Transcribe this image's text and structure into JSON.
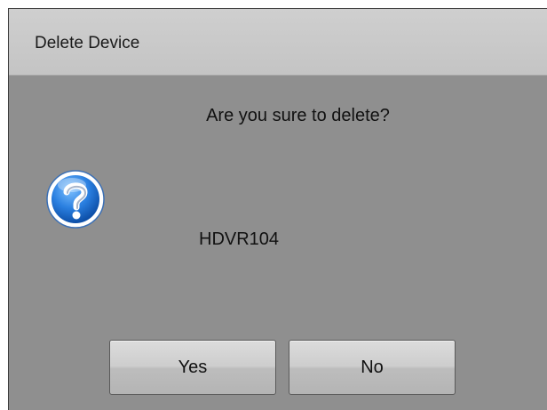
{
  "dialog": {
    "title": "Delete Device",
    "message": "Are you sure to delete?",
    "icon": "question-icon",
    "device_name": "HDVR104",
    "yes_label": "Yes",
    "no_label": "No"
  },
  "colors": {
    "titlebar": "#c8c8c8",
    "body": "#8f8f8f",
    "icon_blue": "#1f6fd6"
  }
}
